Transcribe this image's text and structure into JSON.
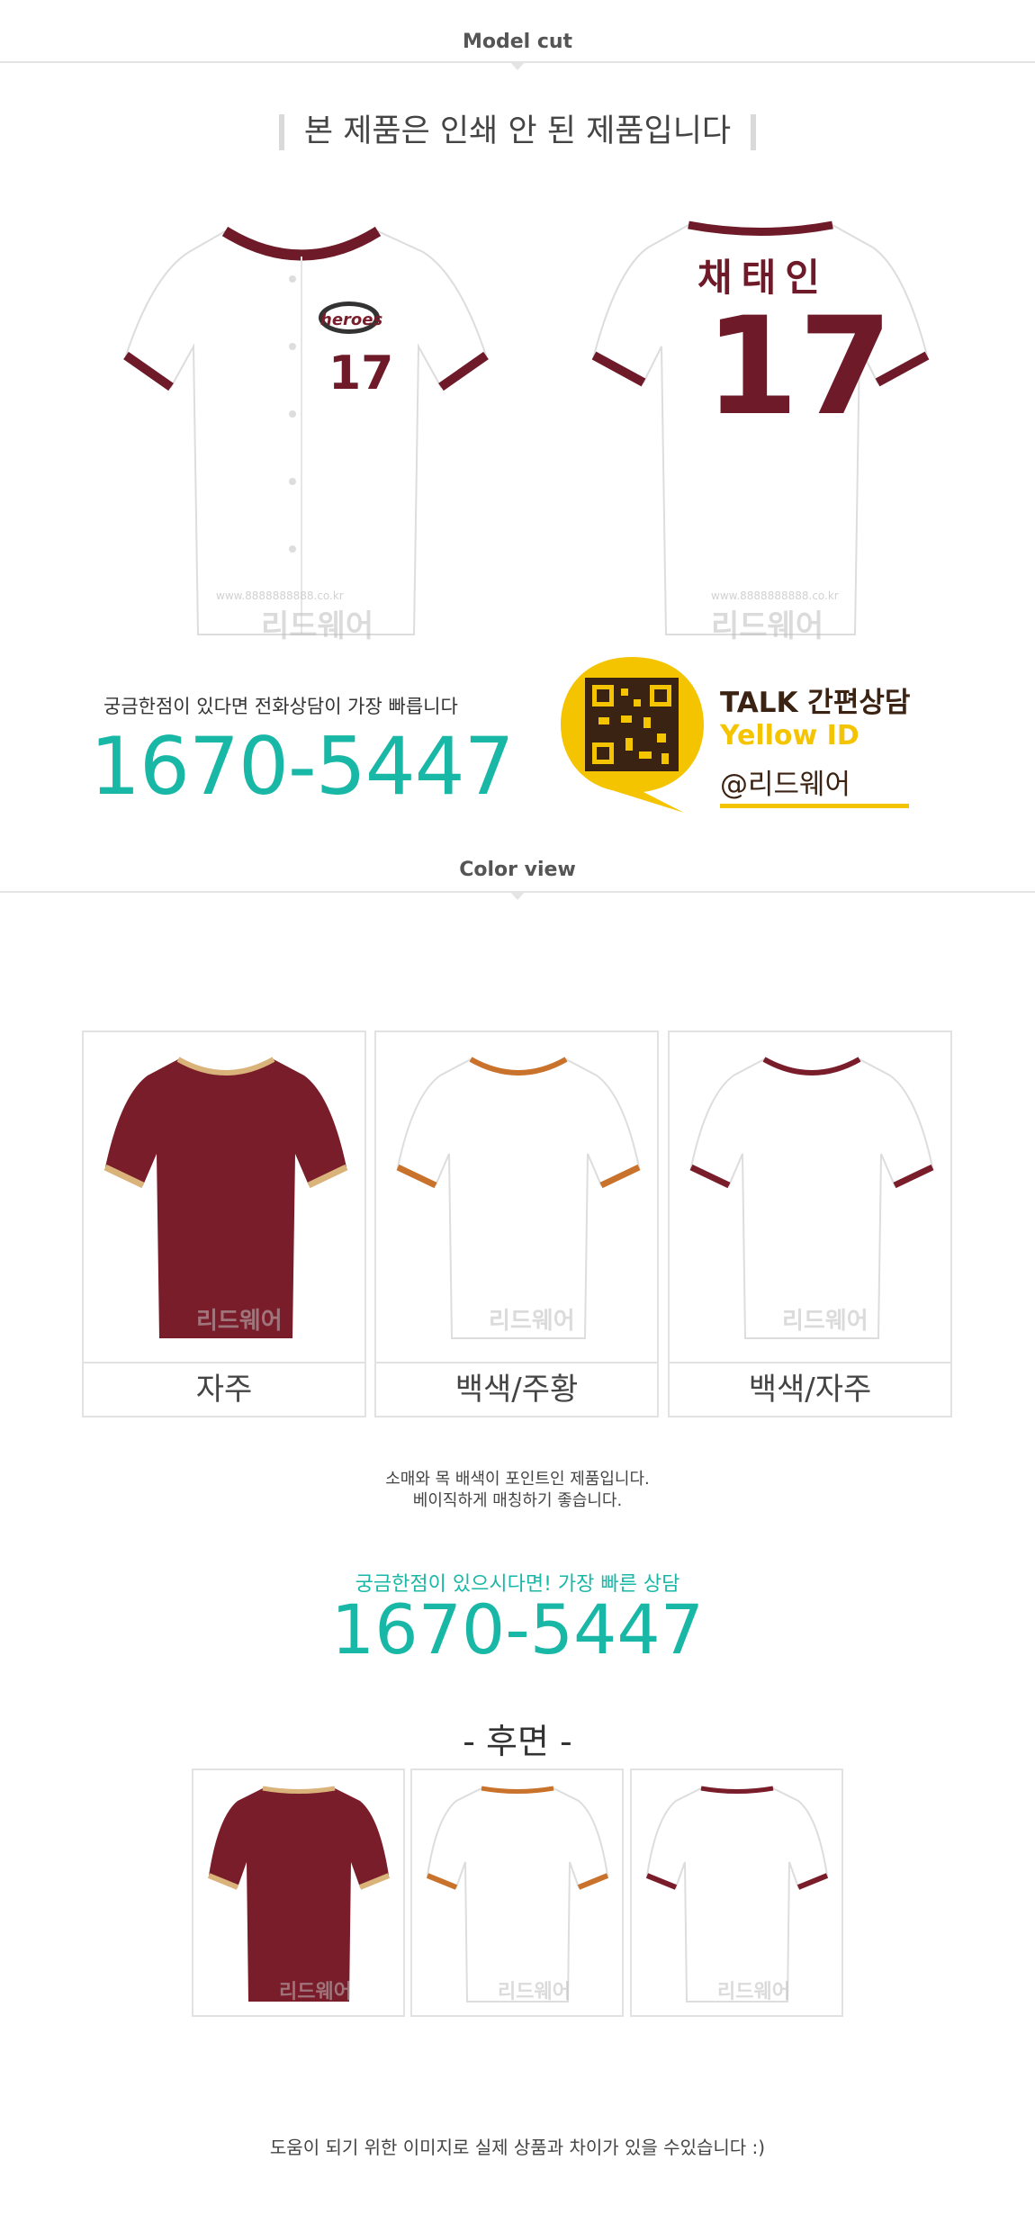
{
  "sections": {
    "model_cut": "Model cut",
    "color_view": "Color view"
  },
  "notice": "본 제품은 인쇄 안 된 제품입니다",
  "front_jersey": {
    "logo_text": "heroes",
    "number": "17"
  },
  "back_jersey": {
    "name": "채태인",
    "number": "17"
  },
  "watermark": {
    "brand": "리드웨어",
    "url": "www.8888888888.co.kr"
  },
  "contact": {
    "question": "궁금한점이 있다면 전화상담이 가장 빠릅니다",
    "phone": "1670-5447",
    "talk_label": "TALK 간편상담",
    "yellow_id": "Yellow ID",
    "kakao_id": "@리드웨어"
  },
  "colors": [
    {
      "label": "자주",
      "body": "#7a1d2b",
      "trim": "#d9b37a"
    },
    {
      "label": "백색/주황",
      "body": "#ffffff",
      "trim": "#c8722c"
    },
    {
      "label": "백색/자주",
      "body": "#ffffff",
      "trim": "#7a1d2b"
    }
  ],
  "description": {
    "line1": "소매와 목 배색이 포인트인 제품입니다.",
    "line2": "베이직하게 매칭하기 좋습니다."
  },
  "consult": {
    "question": "궁금한점이 있으시다면! 가장 빠른 상담",
    "phone": "1670-5447"
  },
  "back_view_title": "- 후면 -",
  "footer": "도움이 되기 위한 이미지로 실제 상품과 차이가 있을 수있습니다 :)"
}
